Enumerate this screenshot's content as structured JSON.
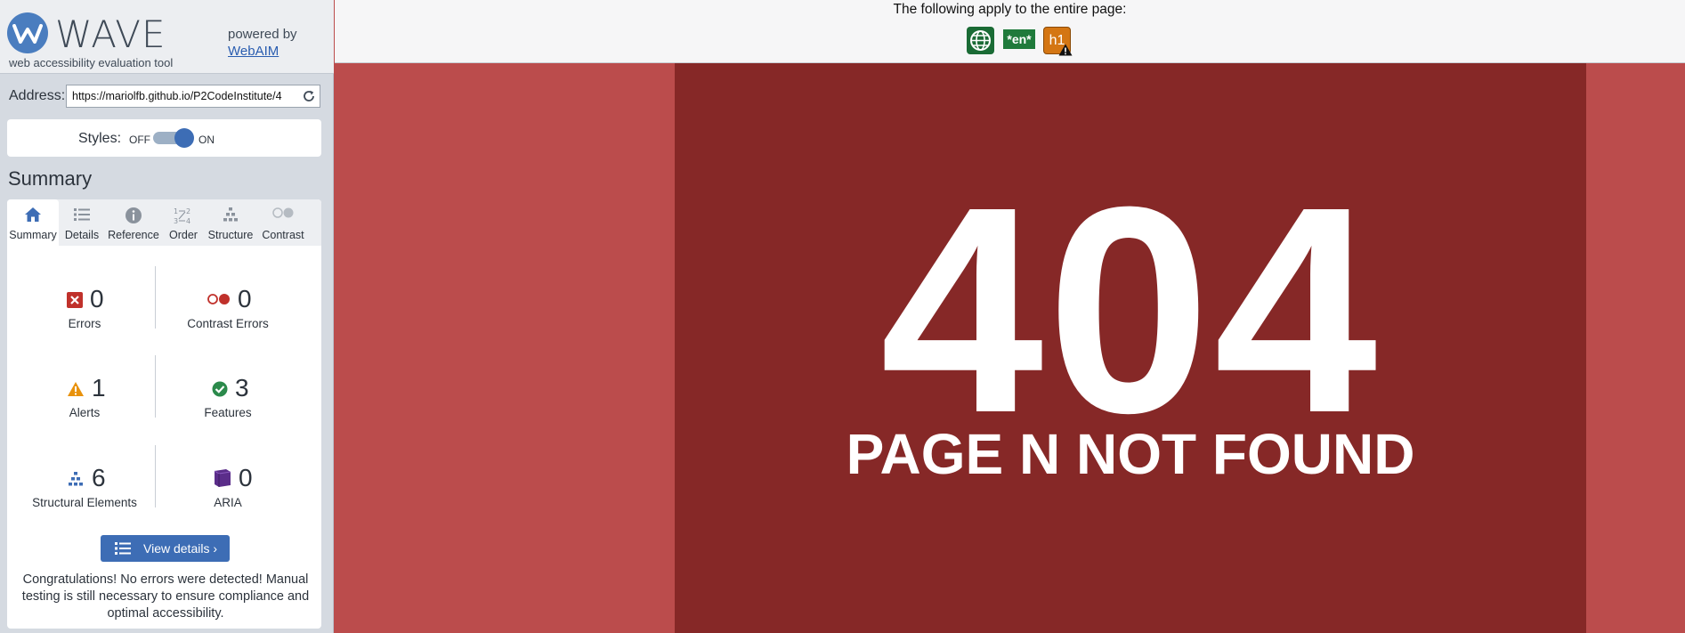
{
  "brand": {
    "logo_text": "WAVE",
    "tagline": "web accessibility evaluation tool",
    "powered_by": "powered by",
    "webaim_link": "WebAIM"
  },
  "address": {
    "label": "Address:",
    "value": "https://mariolfb.github.io/P2CodeInstitute/4"
  },
  "styles": {
    "label": "Styles:",
    "off_label": "OFF",
    "on_label": "ON",
    "state": "on"
  },
  "summary_heading": "Summary",
  "tabs": [
    {
      "label": "Summary",
      "icon": "home-icon",
      "active": true
    },
    {
      "label": "Details",
      "icon": "list-icon",
      "active": false
    },
    {
      "label": "Reference",
      "icon": "info-icon",
      "active": false
    },
    {
      "label": "Order",
      "icon": "order-icon",
      "active": false
    },
    {
      "label": "Structure",
      "icon": "structure-icon",
      "active": false
    },
    {
      "label": "Contrast",
      "icon": "contrast-icon",
      "active": false
    }
  ],
  "stats": {
    "errors": {
      "count": "0",
      "label": "Errors",
      "color": "#c0312b"
    },
    "contrast_errors": {
      "count": "0",
      "label": "Contrast Errors",
      "color": "#c0312b"
    },
    "alerts": {
      "count": "1",
      "label": "Alerts",
      "color": "#e8920c"
    },
    "features": {
      "count": "3",
      "label": "Features",
      "color": "#2b8a4b"
    },
    "structural": {
      "count": "6",
      "label": "Structural Elements",
      "color": "#3d6db5"
    },
    "aria": {
      "count": "0",
      "label": "ARIA",
      "color": "#5b2d8a"
    }
  },
  "view_details_label": "View details ›",
  "congrats": "Congratulations! No errors were detected! Manual testing is still necessary to ensure compliance and optimal accessibility.",
  "topbar": {
    "text": "The following apply to the entire page:",
    "icons": [
      "language-icon",
      "en-badge",
      "h1-badge"
    ],
    "en_label": "*en*",
    "h1_label": "h1"
  },
  "page": {
    "code": "404",
    "message": "PAGE N NOT FOUND"
  }
}
